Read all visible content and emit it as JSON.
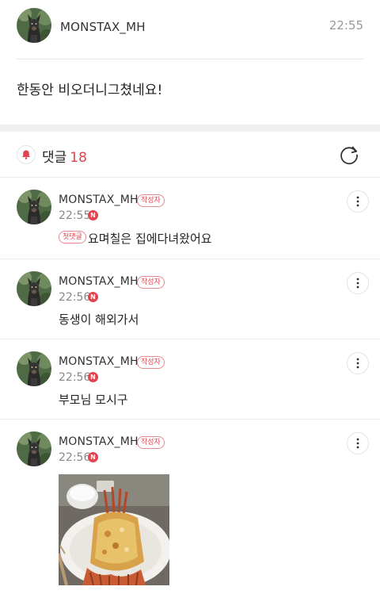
{
  "post": {
    "author": "MONSTAX_MH",
    "time": "22:55",
    "body": "한동안 비오더니그쳤네요!"
  },
  "comments_header": {
    "title": "댓글",
    "count": "18"
  },
  "comments": [
    {
      "author": "MONSTAX_MH",
      "badge": "작성자",
      "time": "22:55",
      "new_badge": "N",
      "first_badge": "첫댓글",
      "text": "요며칠은 집에다녀왔어요"
    },
    {
      "author": "MONSTAX_MH",
      "badge": "작성자",
      "time": "22:56",
      "new_badge": "N",
      "text": "동생이 해외가서"
    },
    {
      "author": "MONSTAX_MH",
      "badge": "작성자",
      "time": "22:56",
      "new_badge": "N",
      "text": "부모님 모시구"
    },
    {
      "author": "MONSTAX_MH",
      "badge": "작성자",
      "time": "22:56",
      "new_badge": "N"
    }
  ],
  "icons": {
    "bell": "bell-icon",
    "refresh": "refresh-icon",
    "more": "more-vertical-icon"
  },
  "colors": {
    "accent": "#e0454f",
    "separator": "#f0f0f3"
  }
}
